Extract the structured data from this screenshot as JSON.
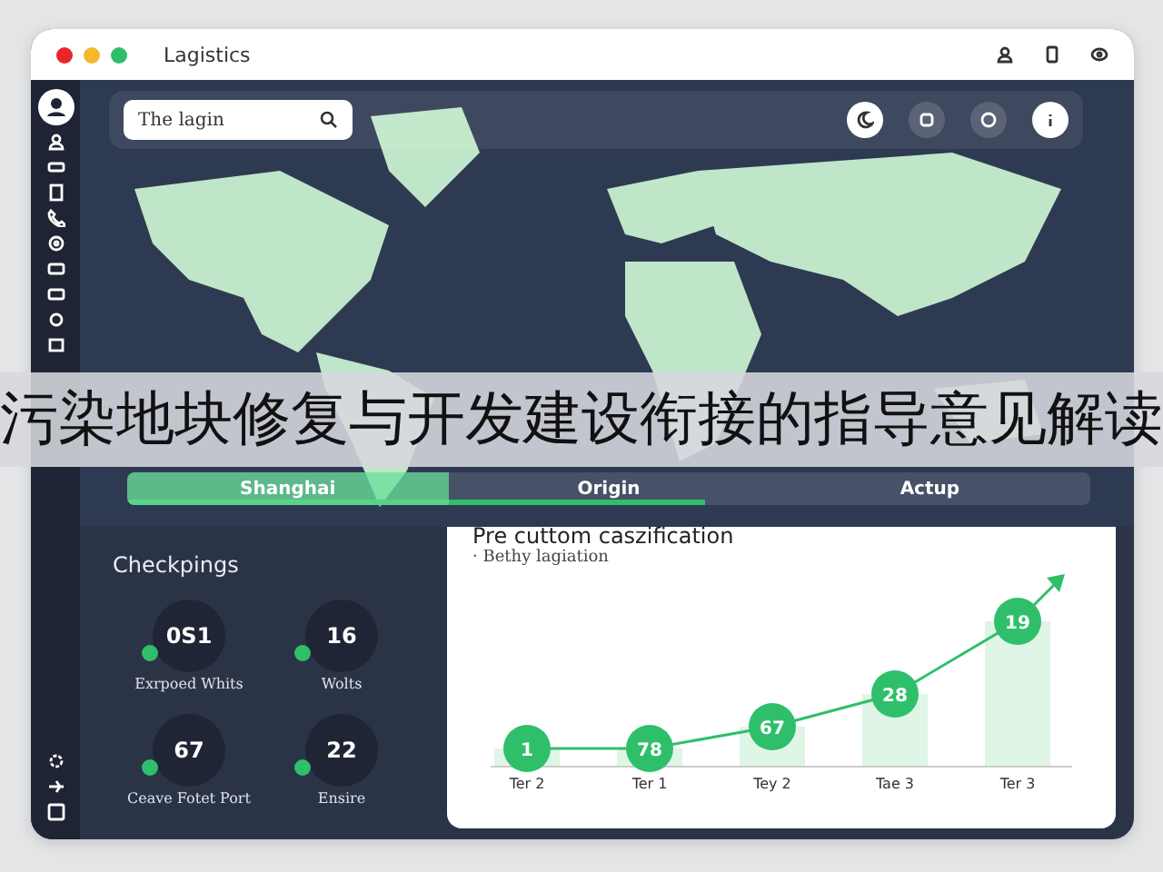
{
  "banner": {
    "text": "污染地块修复与开发建设衔接的指导意见解读"
  },
  "window": {
    "title": "Lagistics"
  },
  "search": {
    "value": "The lagin"
  },
  "tabs": [
    {
      "label": "Shanghai",
      "selected": true
    },
    {
      "label": "Origin",
      "selected": false
    },
    {
      "label": "Actup",
      "selected": false
    }
  ],
  "route_progress": {
    "level": 0.6
  },
  "checkpoints": {
    "title": "Checkpings",
    "items": [
      {
        "value": "0S1",
        "label": "Exrpoed Whits",
        "color": "#2fbf6a"
      },
      {
        "value": "16",
        "label": "Wolts",
        "color": "#2fbf6a"
      },
      {
        "value": "67",
        "label": "Ceave Fotet Port",
        "color": "#2fbf6a"
      },
      {
        "value": "22",
        "label": "Ensire",
        "color": "#2fbf6a"
      }
    ]
  },
  "chart": {
    "title": "Pre cuttom caszification",
    "subtitle": "· Bethy lagiation",
    "points": [
      {
        "label": "1",
        "category": "Ter 2"
      },
      {
        "label": "78",
        "category": "Ter 1"
      },
      {
        "label": "67",
        "category": "Tey 2"
      },
      {
        "label": "28",
        "category": "Tae 3"
      },
      {
        "label": "19",
        "category": "Ter 3"
      }
    ]
  }
}
